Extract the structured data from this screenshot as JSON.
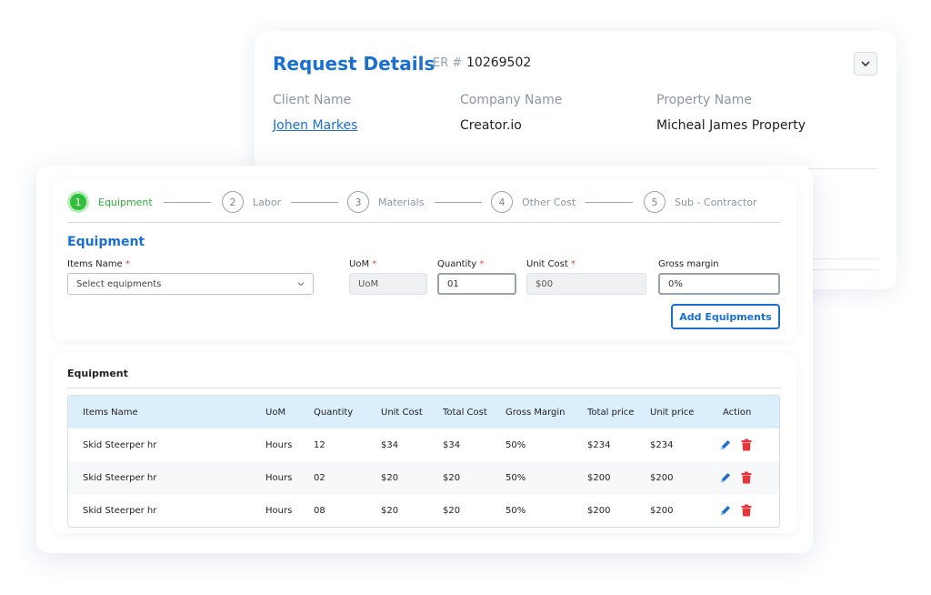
{
  "request": {
    "title": "Request Details",
    "er_label": "ER #",
    "er_number": "10269502",
    "client_label": "Client Name",
    "client_value": "Johen Markes",
    "company_label": "Company Name",
    "company_value": "Creator.io",
    "property_label": "Property Name",
    "property_value": "Micheal James Property"
  },
  "stepper": {
    "steps": [
      {
        "number": "1",
        "label": "Equipment"
      },
      {
        "number": "2",
        "label": "Labor"
      },
      {
        "number": "3",
        "label": "Materials"
      },
      {
        "number": "4",
        "label": "Other Cost"
      },
      {
        "number": "5",
        "label": "Sub - Contractor"
      }
    ],
    "active_step": 1
  },
  "form": {
    "section_title": "Equipment",
    "items_label": "Items Name",
    "items_placeholder": "Select equipments",
    "uom_label": "UoM",
    "uom_value": "UoM",
    "quantity_label": "Quantity",
    "quantity_value": "01",
    "unit_cost_label": "Unit Cost",
    "unit_cost_value": "$00",
    "gross_margin_label": "Gross margin",
    "gross_margin_value": "0%",
    "required_mark": "*",
    "add_button": "Add Equipments"
  },
  "table": {
    "title": "Equipment",
    "headers": [
      "Items Name",
      "UoM",
      "Quantity",
      "Unit Cost",
      "Total Cost",
      "Gross Margin",
      "Total price",
      "Unit price",
      "Action"
    ],
    "rows": [
      [
        "Skid Steerper hr",
        "Hours",
        "12",
        "$34",
        "$34",
        "50%",
        "$234",
        "$234"
      ],
      [
        "Skid Steerper hr",
        "Hours",
        "02",
        "$20",
        "$20",
        "50%",
        "$200",
        "$200"
      ],
      [
        "Skid Steerper hr",
        "Hours",
        "08",
        "$20",
        "$20",
        "50%",
        "$200",
        "$200"
      ]
    ]
  },
  "colors": {
    "primary": "#1a6fd0",
    "active_step": "#2fbf3a",
    "delete": "#e8343b",
    "table_header": "#dbeefc"
  },
  "icons": [
    "chevron-down-icon",
    "edit-pencil-icon",
    "delete-trash-icon"
  ]
}
